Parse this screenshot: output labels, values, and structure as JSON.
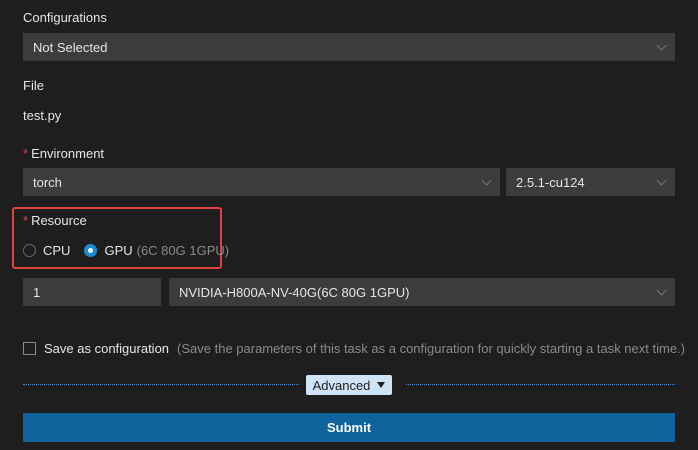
{
  "configurations": {
    "label": "Configurations",
    "value": "Not Selected"
  },
  "file": {
    "label": "File",
    "value": "test.py"
  },
  "environment": {
    "required_mark": "*",
    "label": "Environment",
    "framework": "torch",
    "version": "2.5.1-cu124"
  },
  "resource": {
    "required_mark": "*",
    "label": "Resource",
    "options": [
      {
        "label": "CPU",
        "detail": "",
        "selected": false
      },
      {
        "label": "GPU",
        "detail": "(6C 80G 1GPU)",
        "selected": true
      }
    ],
    "count": "1",
    "spec": "NVIDIA-H800A-NV-40G(6C 80G 1GPU)"
  },
  "save_config": {
    "label": "Save as configuration",
    "hint": "(Save the parameters of this task as a configuration for quickly starting a task next time.)",
    "checked": false
  },
  "advanced": {
    "label": "Advanced"
  },
  "submit": {
    "label": "Submit"
  },
  "colors": {
    "background": "#1e1e1e",
    "field": "#3c3c3c",
    "accent": "#0e639c",
    "radio_selected": "#1a8bd6",
    "highlight_border": "#e0443e"
  }
}
